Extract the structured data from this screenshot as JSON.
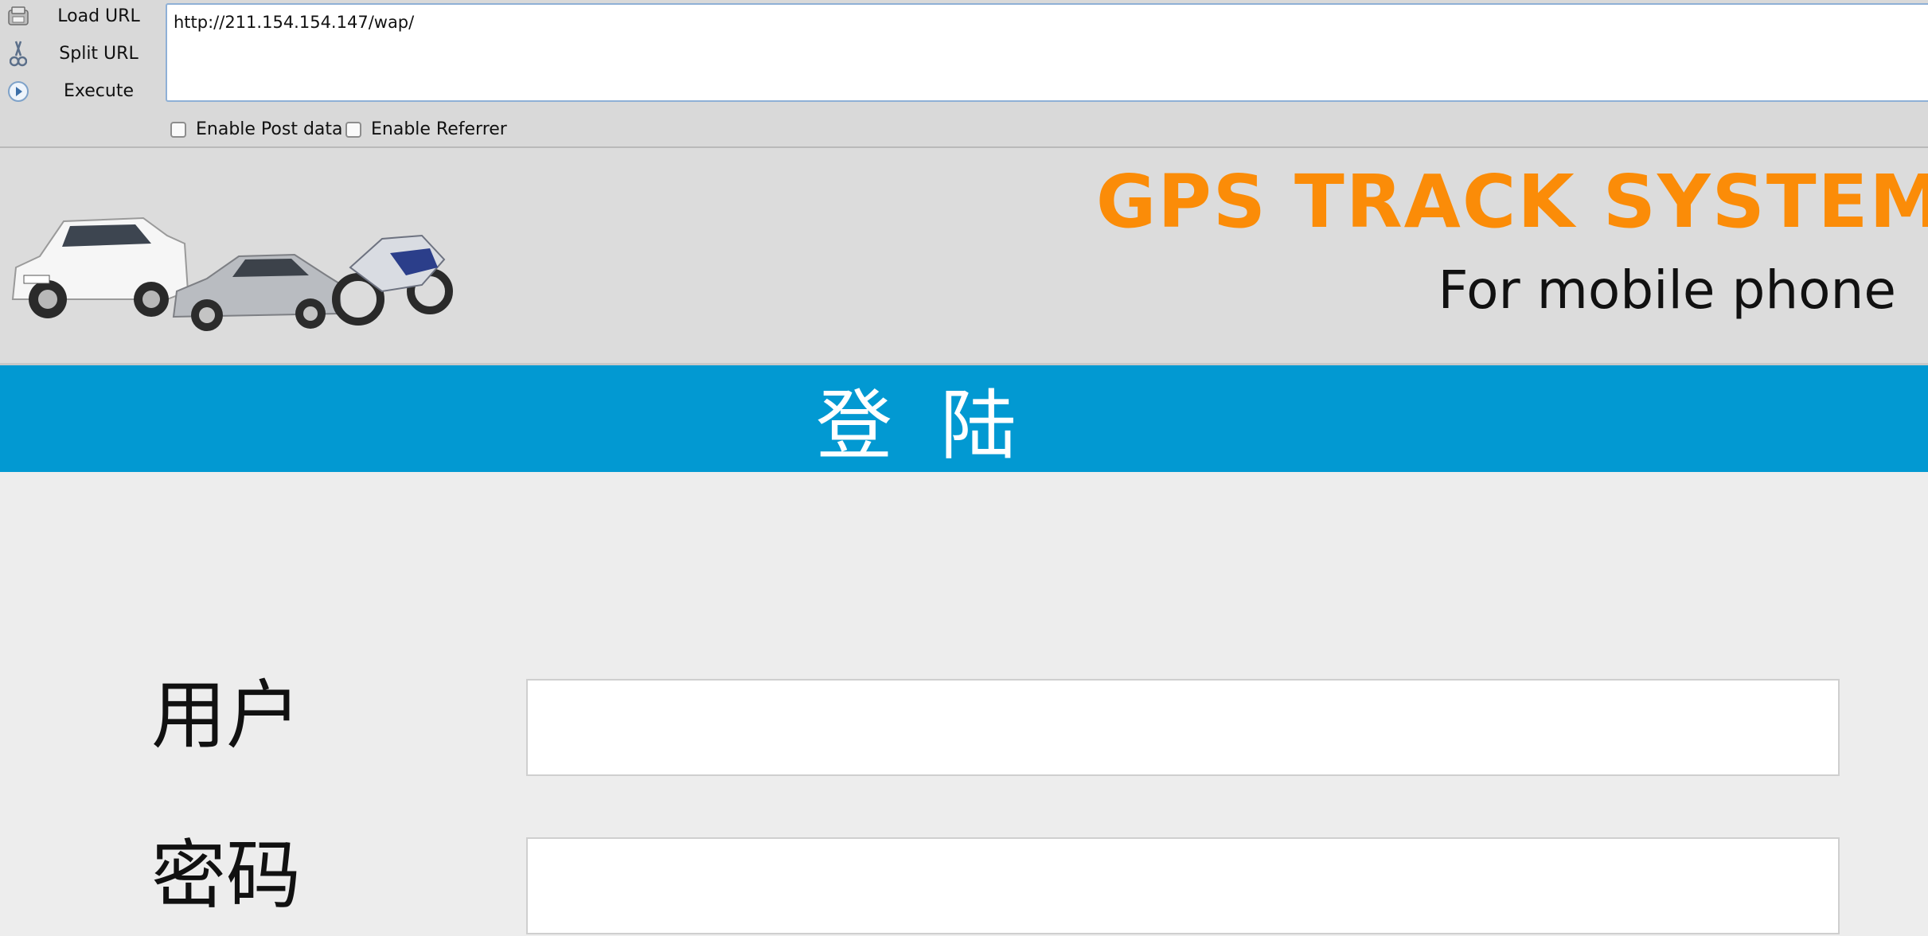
{
  "hackbar": {
    "load_url_label": "Load URL",
    "split_url_label": "Split URL",
    "execute_label": "Execute",
    "url_value": "http://211.154.154.147/wap/",
    "enable_post_label": "Enable Post data",
    "enable_referrer_label": "Enable Referrer",
    "enable_post_checked": false,
    "enable_referrer_checked": false
  },
  "header": {
    "title": "GPS TRACK SYSTEM",
    "subtitle": "For mobile phone",
    "title_color": "#fb8c08"
  },
  "login_bar": {
    "title": "登陆",
    "color": "#0299d2"
  },
  "form": {
    "username_label": "用户",
    "password_label": "密码",
    "username_value": "",
    "password_value": ""
  }
}
